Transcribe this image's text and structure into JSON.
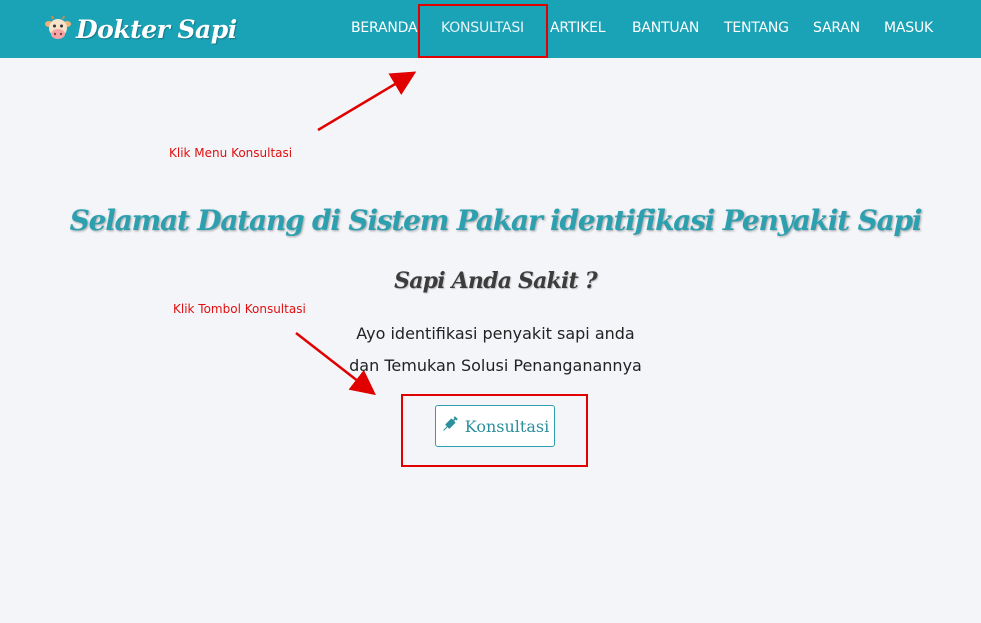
{
  "brand": {
    "name": "Dokter Sapi",
    "logo_icon": "cow-face-icon"
  },
  "nav": {
    "items": [
      {
        "label": "BERANDA"
      },
      {
        "label": "KONSULTASI",
        "active": true
      },
      {
        "label": "ARTIKEL"
      },
      {
        "label": "BANTUAN"
      },
      {
        "label": "TENTANG"
      },
      {
        "label": "SARAN"
      },
      {
        "label": "MASUK"
      }
    ]
  },
  "annotations": {
    "menu_hint": "Klik Menu Konsultasi",
    "button_hint": "Klik Tombol Konsultasi",
    "color": "#e00000"
  },
  "hero": {
    "title": "Selamat Datang di Sistem Pakar identifikasi Penyakit Sapi",
    "subtitle": "Sapi Anda Sakit ?",
    "line1": "Ayo identifikasi penyakit sapi anda",
    "line2": "dan Temukan Solusi Penanganannya",
    "cta_label": "Konsultasi",
    "cta_icon": "syringe-icon"
  },
  "colors": {
    "navbar": "#1aa2b6",
    "accent": "#2ca0ae",
    "background": "#f4f5f9"
  }
}
